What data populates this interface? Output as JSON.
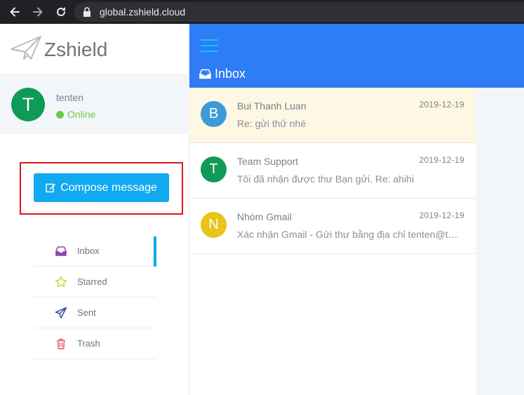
{
  "browser": {
    "url": "global.zshield.cloud"
  },
  "app": {
    "logo_text": "Zshield"
  },
  "user": {
    "initial": "T",
    "name": "tenten",
    "status": "Online",
    "avatar_color": "#109a57"
  },
  "compose": {
    "label": "Compose message"
  },
  "nav": [
    {
      "label": "Inbox",
      "icon": "inbox-icon",
      "active": true,
      "color": "#8e44ad"
    },
    {
      "label": "Starred",
      "icon": "star-icon",
      "active": false,
      "color": "#c6d93f"
    },
    {
      "label": "Sent",
      "icon": "paper-plane-icon",
      "active": false,
      "color": "#3a4aa0"
    },
    {
      "label": "Trash",
      "icon": "trash-icon",
      "active": false,
      "color": "#e85a6a"
    }
  ],
  "header": {
    "title": "Inbox"
  },
  "messages": [
    {
      "initial": "B",
      "from": "Bui Thanh Luan",
      "date": "2019-12-19",
      "snippet": "Re: gửi thử nhé",
      "color": "#3d9ad8",
      "unread": true
    },
    {
      "initial": "T",
      "from": "Team Support",
      "date": "2019-12-19",
      "snippet": "Tôi đã nhận được thư Bạn gửi. Re: ahihi",
      "color": "#109a57",
      "unread": false
    },
    {
      "initial": "N",
      "from": "Nhóm Gmail",
      "date": "2019-12-19",
      "snippet": "Xác nhận Gmail - Gửi thư bằng địa chỉ tenten@tenten.vn",
      "color": "#e7c51b",
      "unread": false
    }
  ],
  "colors": {
    "accent": "#11a9ef",
    "topbar": "#2e7cf6",
    "highlight": "#e0141a"
  }
}
